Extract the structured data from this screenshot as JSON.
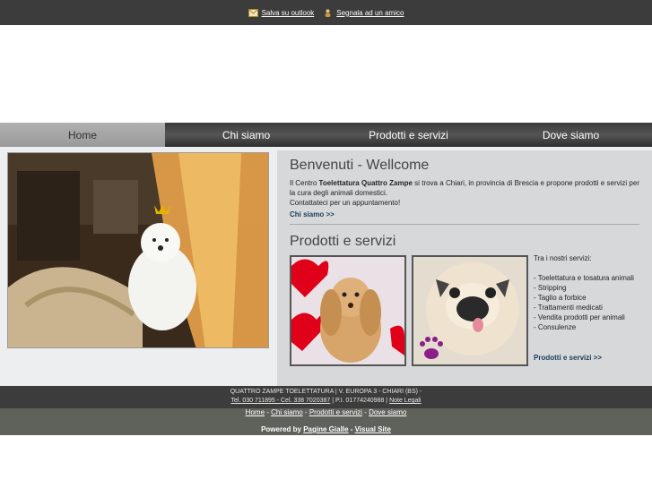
{
  "topbar": {
    "outlook_label": "Salva su outlook",
    "friend_label": "Segnala ad un amico",
    "outlook_icon": "envelope-icon",
    "friend_icon": "person-icon"
  },
  "nav": {
    "items": [
      {
        "label": "Home",
        "active": true
      },
      {
        "label": "Chi siamo"
      },
      {
        "label": "Prodotti e servizi"
      },
      {
        "label": "Dove siamo"
      }
    ]
  },
  "welcome": {
    "title": "Benvenuti - Wellcome",
    "text_prefix": "Il Centro ",
    "text_bold": "Toelettatura Quattro Zampe",
    "text_suffix": " si trova a Chiari, in provincia di Brescia e propone prodotti e servizi per la cura degli animali domestici.",
    "text_line2": "Contattateci per un appuntamento!",
    "more_link": "Chi siamo >>"
  },
  "services": {
    "title": "Prodotti e servizi",
    "intro": "Tra i nostri servizi:",
    "items": [
      "- Toelettatura e tosatura animali",
      "- Stripping",
      "- Taglio a forbice",
      "- Trattamenti medicati",
      "- Vendita prodotti per animali",
      "- Consulenze"
    ],
    "more_link": "Prodotti e servizi >>"
  },
  "footer": {
    "address": "QUATTRO ZAMPE TOELETTATURA | V. EUROPA 3 - CHIARI (BS) -",
    "phone": "Tel. 030 711895 - Cel. 338 7020387",
    "piva": " | P.I. 01774240988 | ",
    "legal": "Note Legali",
    "links": [
      "Home",
      "Chi siamo",
      "Prodotti e servizi",
      "Dove siamo"
    ],
    "powered_label": "Powered by",
    "powered_link1": "Pagine Gialle",
    "powered_sep": " - ",
    "powered_link2": "Visual Site"
  },
  "colors": {
    "topbar_bg": "#3c3c3c",
    "nav_active_bg": "#a5a5a5",
    "content_bg": "#eceeef",
    "rightcol_bg": "#d6d8d9",
    "link_color": "#1d3c5a"
  }
}
